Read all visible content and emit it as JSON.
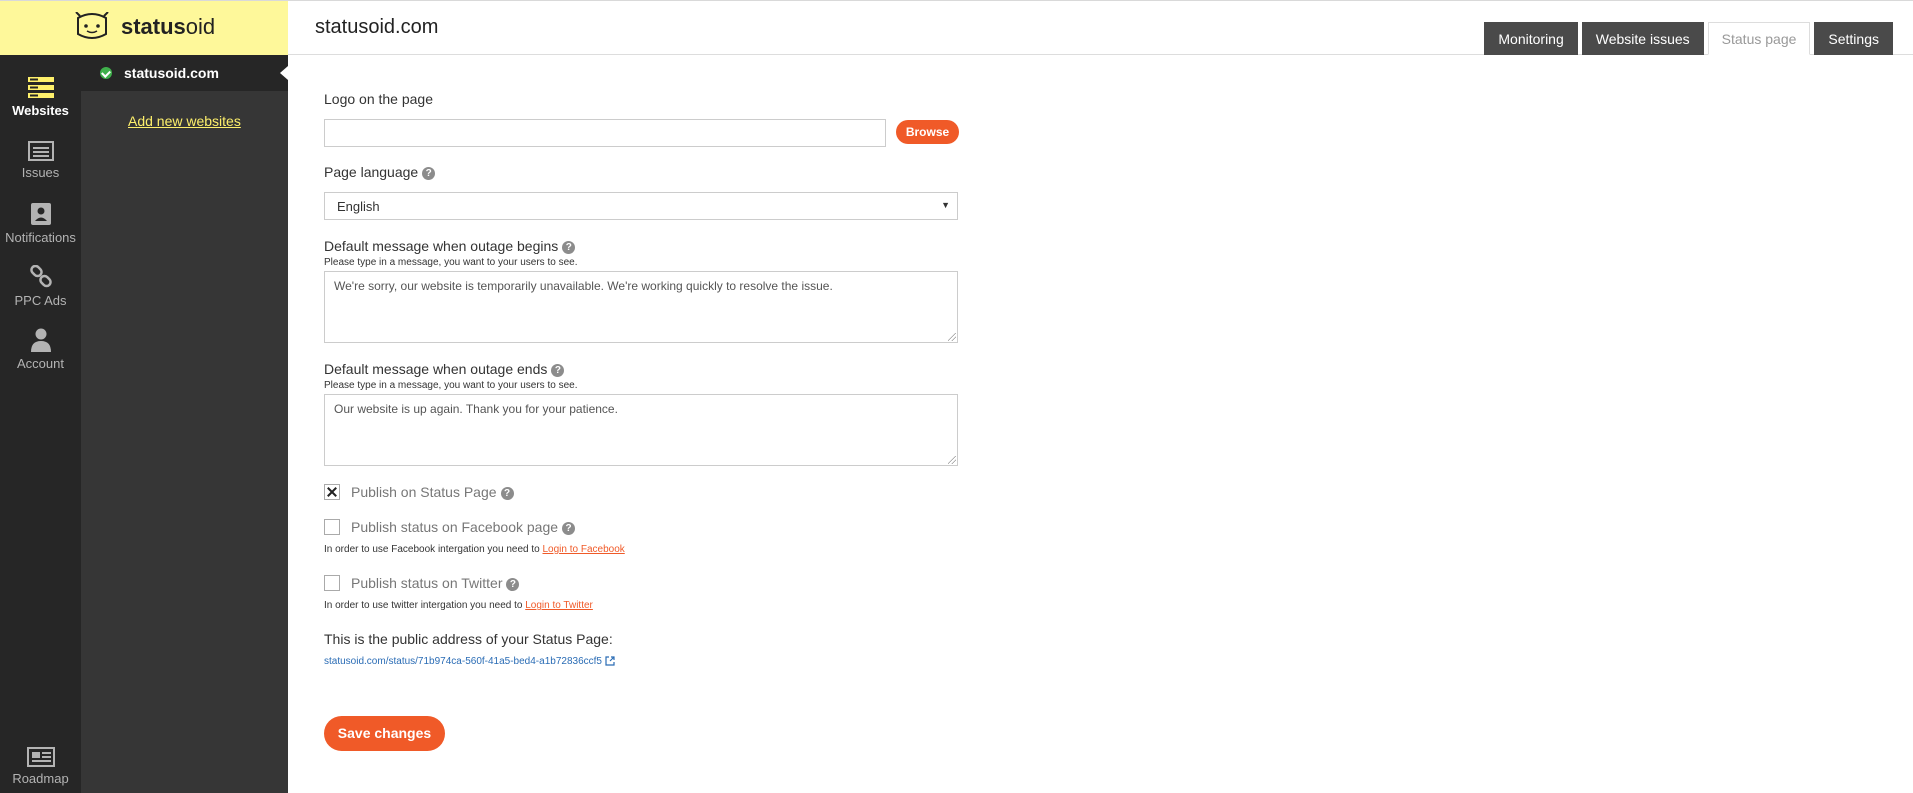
{
  "brand": {
    "name_bold": "status",
    "name_rest": "oid",
    "bg": "#fef89a"
  },
  "nav": {
    "items": [
      {
        "label": "Websites",
        "icon": "websites-icon"
      },
      {
        "label": "Issues",
        "icon": "issues-icon"
      },
      {
        "label": "Notifications",
        "icon": "notifications-icon"
      },
      {
        "label": "PPC Ads",
        "icon": "link-icon"
      },
      {
        "label": "Account",
        "icon": "user-icon"
      }
    ],
    "roadmap": "Roadmap"
  },
  "sites": {
    "current": "statusoid.com",
    "add_link": "Add new websites"
  },
  "header": {
    "title": "statusoid.com",
    "tabs": [
      "Monitoring",
      "Website issues",
      "Status page",
      "Settings"
    ],
    "active_tab": "Status page"
  },
  "form": {
    "logo_label": "Logo on the page",
    "browse": "Browse",
    "language_label": "Page language",
    "language_value": "English",
    "outage_begins_label": "Default message when outage begins",
    "outage_begins_sub": "Please type in a message, you want to your users to see.",
    "outage_begins_text": "We're sorry, our website is temporarily unavailable. We're working quickly to resolve the issue.",
    "outage_ends_label": "Default message when outage ends",
    "outage_ends_sub": "Please type in a message, you want to your users to see.",
    "outage_ends_text": "Our website is up again. Thank you for your patience.",
    "publish_status_page": "Publish on Status Page",
    "publish_status_page_checked": true,
    "publish_facebook": "Publish status on Facebook page",
    "facebook_note": "In order to use Facebook intergation you need to",
    "facebook_link": "Login to Facebook",
    "publish_twitter": "Publish status on Twitter",
    "twitter_note": "In order to use twitter intergation you need to",
    "twitter_link": "Login to Twitter",
    "public_address_label": "This is the public address of your Status Page:",
    "public_url": "statusoid.com/status/71b974ca-560f-41a5-bed4-a1b72836ccf5",
    "save": "Save changes"
  },
  "colors": {
    "accent": "#f05a28",
    "nav_bg": "#262626",
    "link_yellow": "#fef06b"
  }
}
